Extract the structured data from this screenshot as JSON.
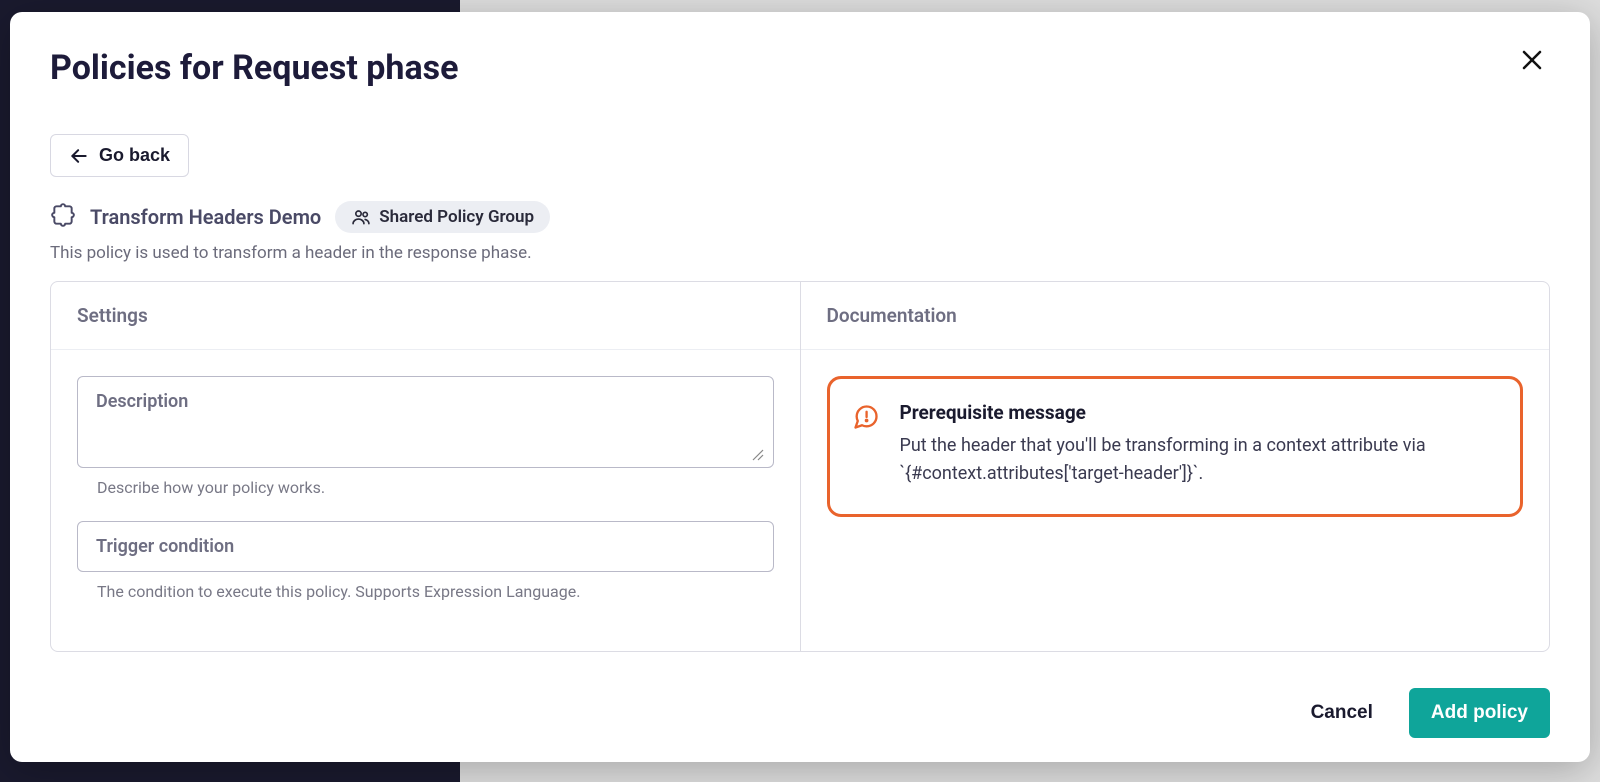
{
  "modal": {
    "title": "Policies for Request phase",
    "go_back_label": "Go back",
    "policy_name": "Transform Headers Demo",
    "shared_badge_label": "Shared Policy Group",
    "policy_description": "This policy is used to transform a header in the response phase."
  },
  "settings_panel": {
    "header": "Settings",
    "description_field": {
      "label": "Description",
      "value": "",
      "help": "Describe how your policy works."
    },
    "trigger_field": {
      "label": "Trigger condition",
      "value": "",
      "help": "The condition to execute this policy. Supports Expression Language."
    }
  },
  "documentation_panel": {
    "header": "Documentation",
    "callout": {
      "title": "Prerequisite message",
      "text": "Put the header that you'll be transforming in a context attribute via `{#context.attributes['target-header']}`."
    }
  },
  "footer": {
    "cancel_label": "Cancel",
    "submit_label": "Add policy"
  }
}
